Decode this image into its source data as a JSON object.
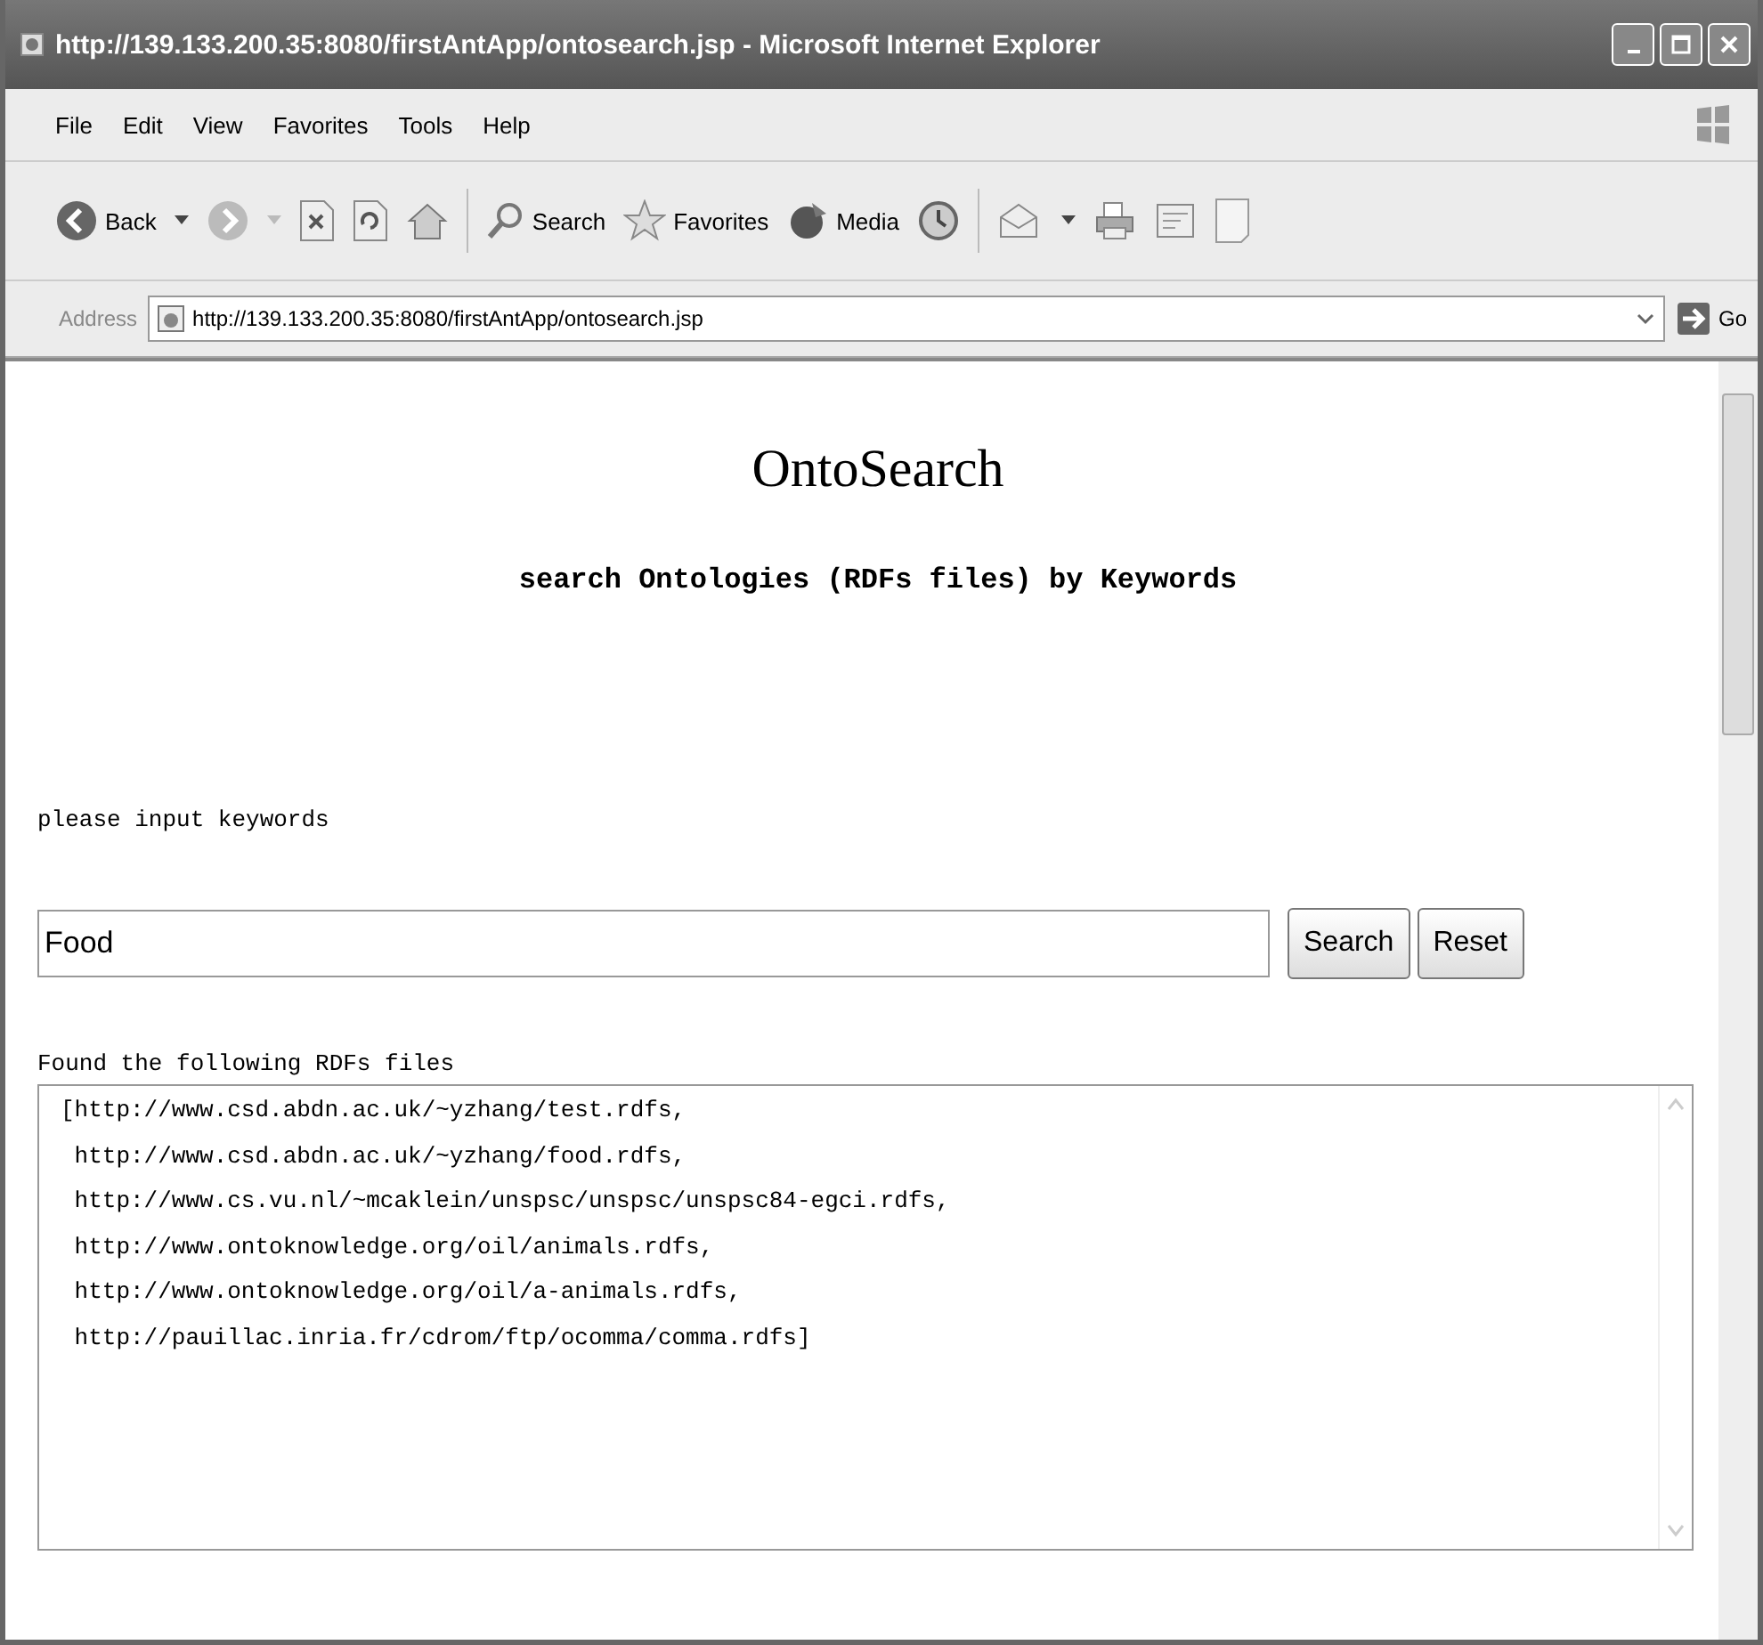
{
  "window": {
    "title": "http://139.133.200.35:8080/firstAntApp/ontosearch.jsp - Microsoft Internet Explorer"
  },
  "menu": [
    "File",
    "Edit",
    "View",
    "Favorites",
    "Tools",
    "Help"
  ],
  "toolbar": {
    "back": "Back",
    "search": "Search",
    "favorites": "Favorites",
    "media": "Media"
  },
  "address_bar": {
    "label": "Address",
    "value": "http://139.133.200.35:8080/firstAntApp/ontosearch.jsp",
    "go": "Go"
  },
  "page": {
    "heading": "OntoSearch",
    "subtitle": "search Ontologies (RDFs files) by Keywords",
    "prompt": "please input keywords",
    "search_field": {
      "value": "Food"
    },
    "buttons": [
      "Search",
      "Reset"
    ],
    "results_label": "Found the following RDFs files",
    "results": [
      "[http://www.csd.abdn.ac.uk/~yzhang/test.rdfs,",
      " http://www.csd.abdn.ac.uk/~yzhang/food.rdfs,",
      " http://www.cs.vu.nl/~mcaklein/unspsc/unspsc/unspsc84-egci.rdfs,",
      " http://www.ontoknowledge.org/oil/animals.rdfs,",
      " http://www.ontoknowledge.org/oil/a-animals.rdfs,",
      " http://pauillac.inria.fr/cdrom/ftp/ocomma/comma.rdfs]"
    ]
  }
}
